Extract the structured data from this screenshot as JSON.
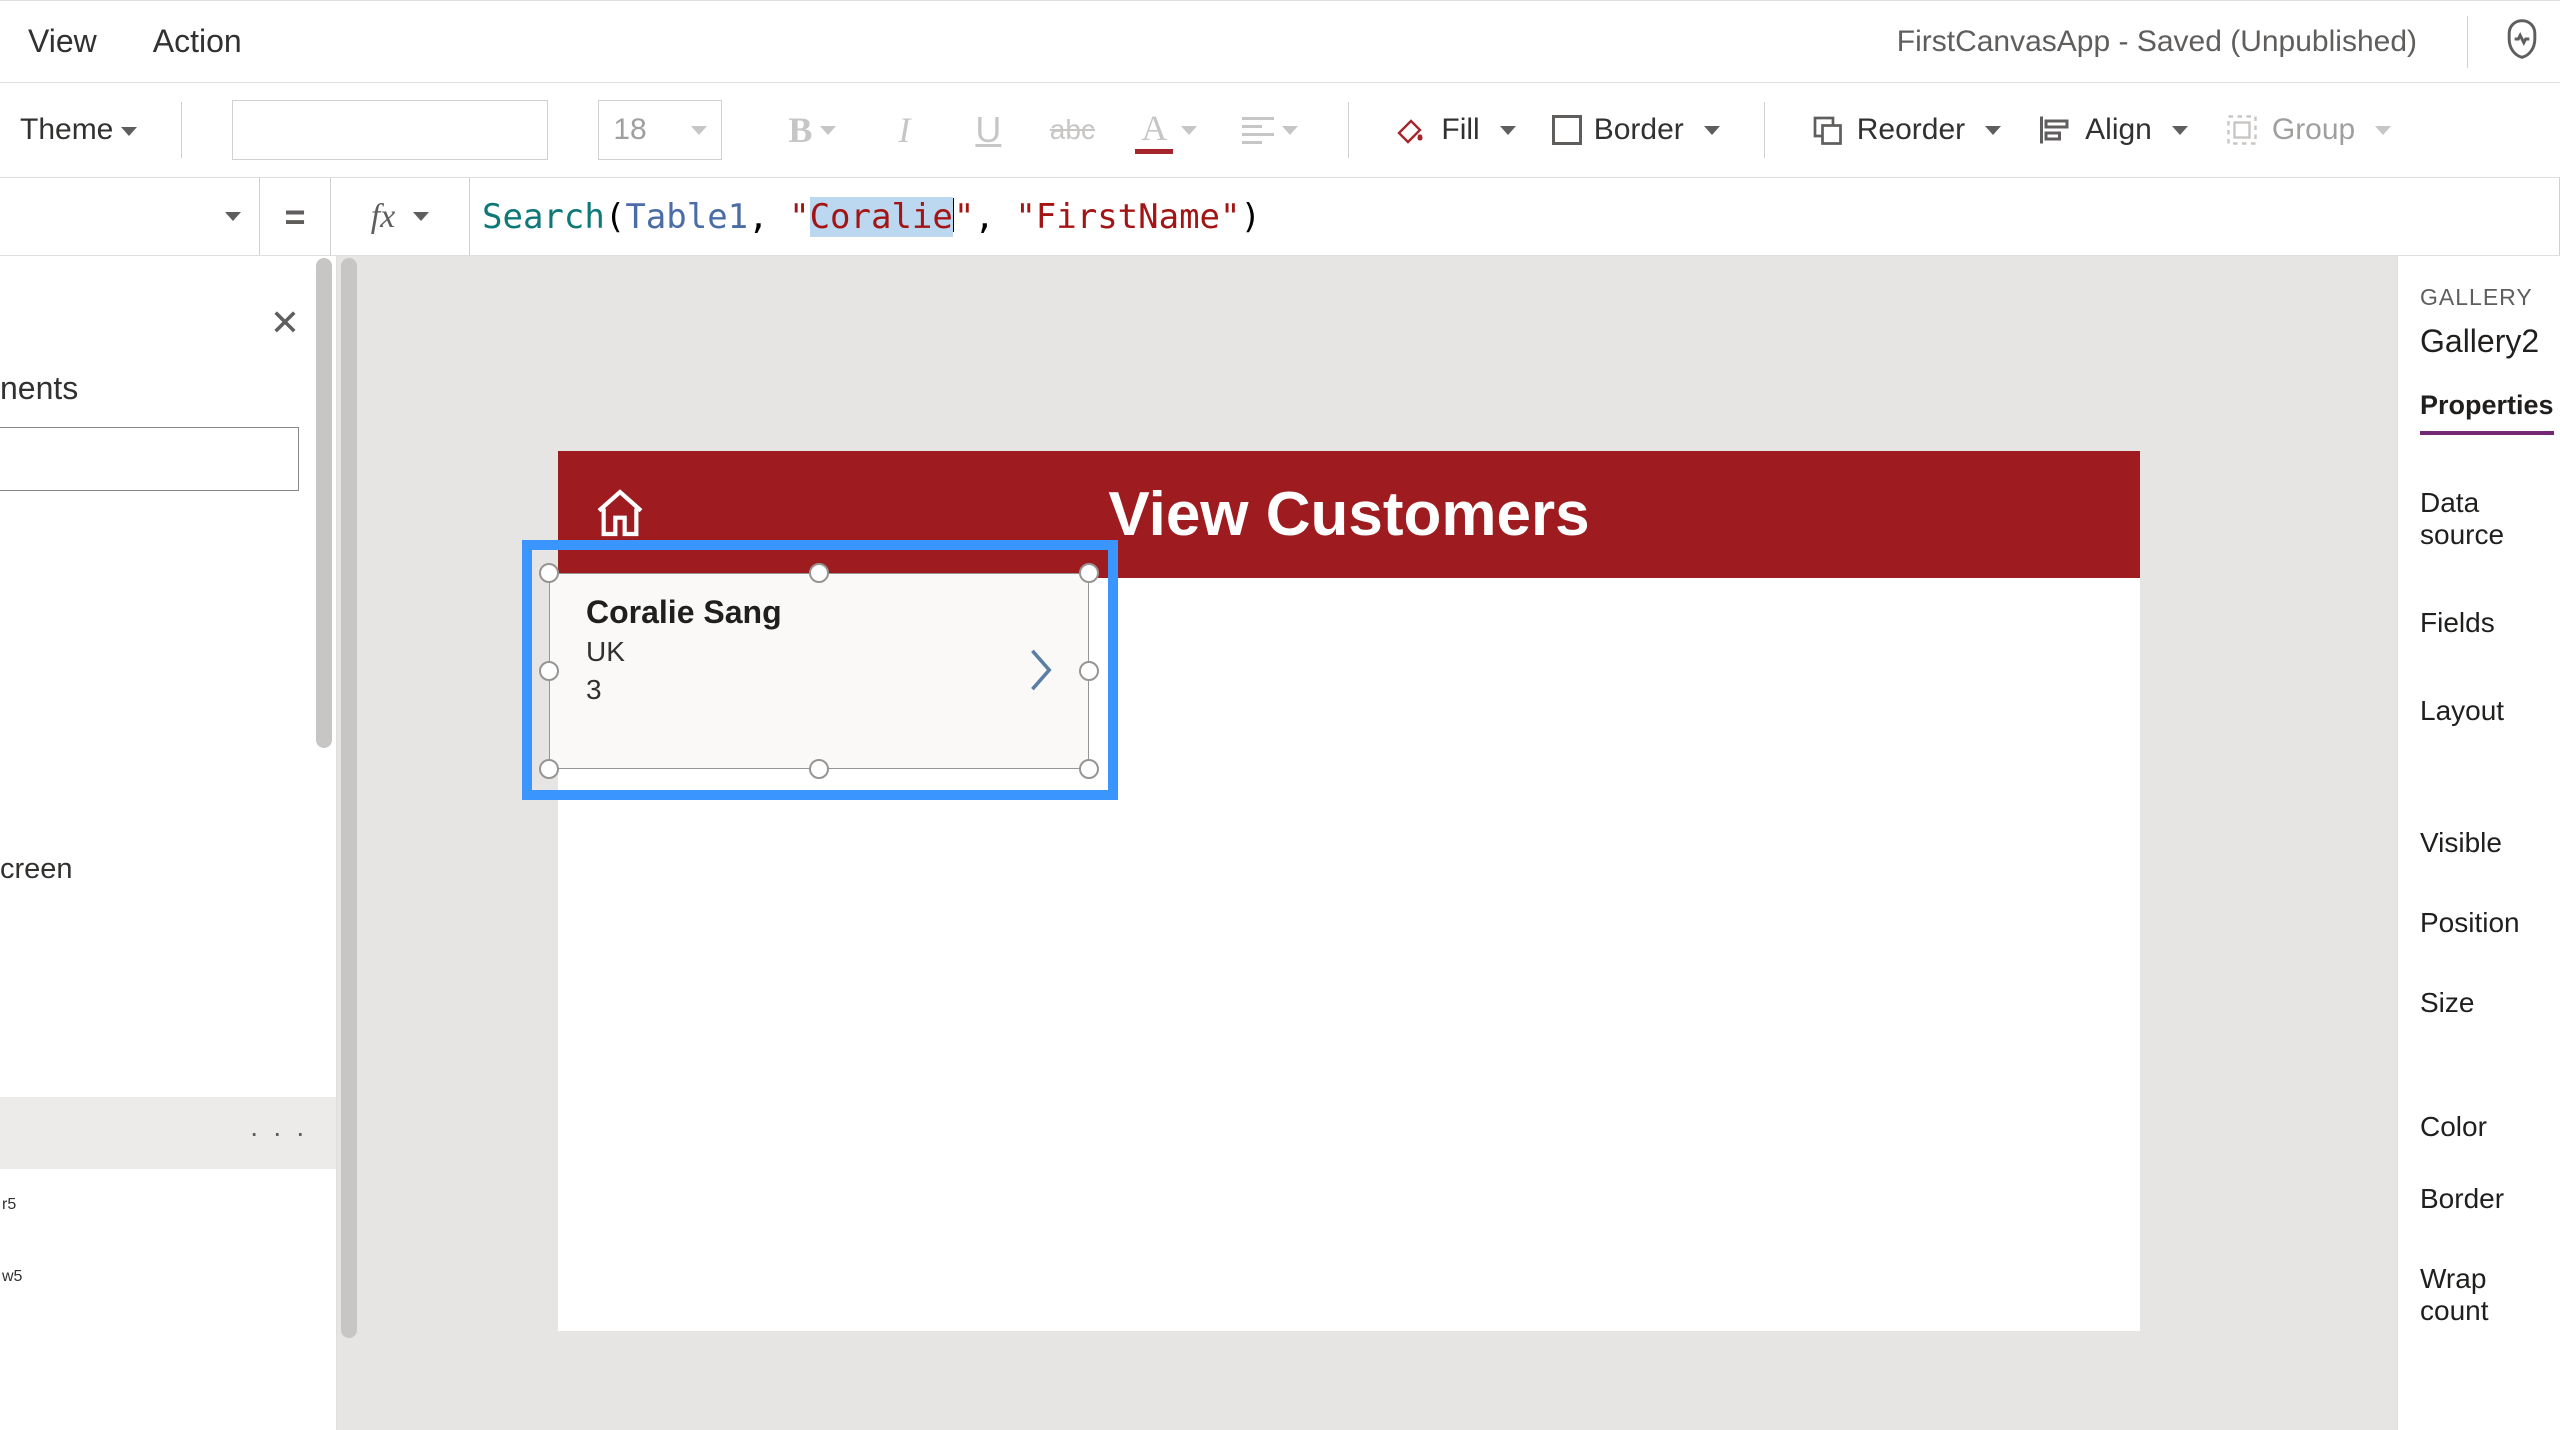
{
  "menu": {
    "view": "View",
    "action": "Action",
    "app_title": "FirstCanvasApp - Saved (Unpublished)"
  },
  "toolbar": {
    "theme": "Theme",
    "font_size": "18",
    "fill": "Fill",
    "border": "Border",
    "reorder": "Reorder",
    "align": "Align",
    "group": "Group"
  },
  "formula": {
    "equals": "=",
    "fx": "fx",
    "fn": "Search",
    "open": "(",
    "tbl": "Table1",
    "comma1": ", ",
    "q1": "\"",
    "sel": "Coralie",
    "q2": "\"",
    "comma2": ", ",
    "q3": "\"",
    "field": "FirstName",
    "q4": "\"",
    "close": ")"
  },
  "tree": {
    "tab_components": "nents",
    "section_screen": "creen",
    "row_r5": "r5",
    "row_w5": "w5"
  },
  "canvas": {
    "header_title": "View Customers",
    "item": {
      "title": "Coralie  Sang",
      "sub": "UK",
      "num": "3"
    }
  },
  "props": {
    "header": "GALLERY",
    "name": "Gallery2",
    "tab_properties": "Properties",
    "rows": {
      "data_source": "Data source",
      "fields": "Fields",
      "layout": "Layout",
      "visible": "Visible",
      "position": "Position",
      "size": "Size",
      "color": "Color",
      "border": "Border",
      "wrap_count": "Wrap count"
    }
  }
}
